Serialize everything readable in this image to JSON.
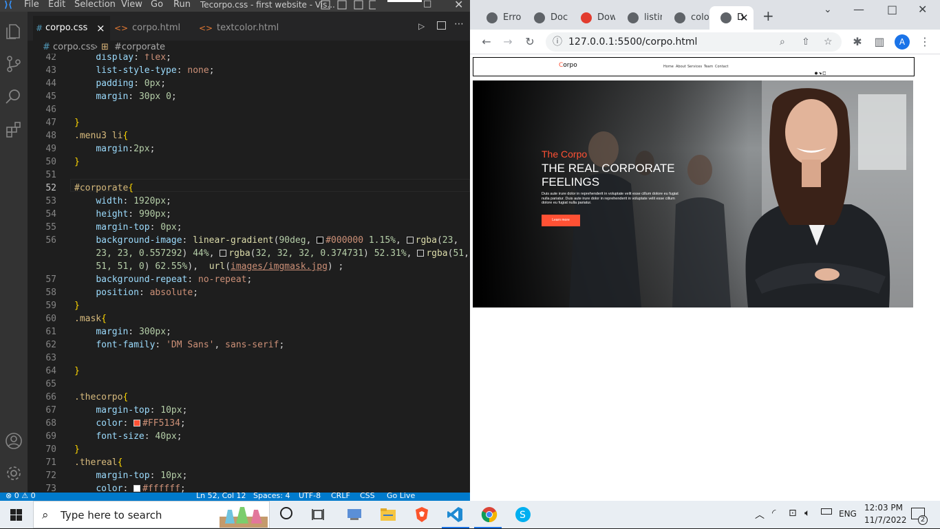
{
  "vscode": {
    "menu": [
      "File",
      "Edit",
      "Selection",
      "View",
      "Go",
      "Run"
    ],
    "window_title": "Tecorpo.css - first website - Vis...",
    "tabs": [
      {
        "label": "corpo.css",
        "icon": "#",
        "close": "×"
      },
      {
        "label": "corpo.html",
        "icon": "<>"
      },
      {
        "label": "textcolor.html",
        "icon": "<>"
      }
    ],
    "breadcrumb": {
      "file": "corpo.css",
      "symbol": "#corporate",
      "sep": "›"
    },
    "lines": [
      {
        "n": "42",
        "t": "    display: flex;"
      },
      {
        "n": "43",
        "t": "    list-style-type: none;"
      },
      {
        "n": "44",
        "t": "    padding: 0px;"
      },
      {
        "n": "45",
        "t": "    margin: 30px 0;"
      },
      {
        "n": "46",
        "t": ""
      },
      {
        "n": "47",
        "t": "}"
      },
      {
        "n": "48",
        "t": ".menu3 li{"
      },
      {
        "n": "49",
        "t": "    margin:2px;"
      },
      {
        "n": "50",
        "t": "}"
      },
      {
        "n": "51",
        "t": ""
      },
      {
        "n": "52",
        "t": "#corporate{"
      },
      {
        "n": "53",
        "t": "    width: 1920px;"
      },
      {
        "n": "54",
        "t": "    height: 990px;"
      },
      {
        "n": "55",
        "t": "    margin-top: 0px;"
      },
      {
        "n": "56",
        "t": "    background-image: linear-gradient(90deg, #000000 1.15%, rgba(23,"
      },
      {
        "n": "",
        "t": "    23, 23, 0.557292) 44%, rgba(32, 32, 32, 0.374731) 52.31%, rgba(51,"
      },
      {
        "n": "",
        "t": "    51, 51, 0) 62.55%),  url(images/imgmask.jpg) ;"
      },
      {
        "n": "57",
        "t": "    background-repeat: no-repeat;"
      },
      {
        "n": "58",
        "t": "    position: absolute;"
      },
      {
        "n": "59",
        "t": "}"
      },
      {
        "n": "60",
        "t": ".mask{"
      },
      {
        "n": "61",
        "t": "    margin: 300px;"
      },
      {
        "n": "62",
        "t": "    font-family: 'DM Sans', sans-serif;"
      },
      {
        "n": "63",
        "t": ""
      },
      {
        "n": "64",
        "t": "}"
      },
      {
        "n": "65",
        "t": ""
      },
      {
        "n": "66",
        "t": ".thecorpo{"
      },
      {
        "n": "67",
        "t": "    margin-top: 10px;"
      },
      {
        "n": "68",
        "t": "    color: #FF5134;"
      },
      {
        "n": "69",
        "t": "    font-size: 40px;"
      },
      {
        "n": "70",
        "t": "}"
      },
      {
        "n": "71",
        "t": ".thereal{"
      },
      {
        "n": "72",
        "t": "    margin-top: 10px;"
      },
      {
        "n": "73",
        "t": "    color: #ffffff;"
      }
    ],
    "status": {
      "errors": "⊗ 0 ⚠ 0",
      "position": "Ln 52, Col 12",
      "spaces": "Spaces: 4",
      "encoding": "UTF-8",
      "eol": "CRLF",
      "language": "CSS",
      "golive": "Go Live"
    }
  },
  "chrome": {
    "tabs": [
      {
        "label": "Error"
      },
      {
        "label": "Docu"
      },
      {
        "label": "Dow"
      },
      {
        "label": "listin"
      },
      {
        "label": "color"
      },
      {
        "label": "D"
      }
    ],
    "url": "127.0.0.1:5500/corpo.html",
    "profile_initial": "A",
    "accent": "#1a73e8"
  },
  "site": {
    "logo_first": "C",
    "logo_rest": "orpo",
    "nav": [
      "Home",
      "About",
      "Services",
      "Team",
      "Contact"
    ],
    "hero": {
      "kicker": "The Corpo",
      "headline_1": "THE REAL CORPORATE",
      "headline_2": "FEELINGS",
      "body": "Duis aute irure dolor in reprehenderit in voluptate velit esse cillum dolore eu fugiat nulla pariatur. Duis aute irure dolor in reprehenderit in voluptate velit esse cillum dolore eu fugiat nulla pariatur.",
      "button": "Learn more"
    },
    "accent": "#FF5134"
  },
  "taskbar": {
    "search_placeholder": "Type here to search",
    "language": "ENG",
    "time": "12:03 PM",
    "date": "11/7/2022",
    "notifications": "2"
  }
}
